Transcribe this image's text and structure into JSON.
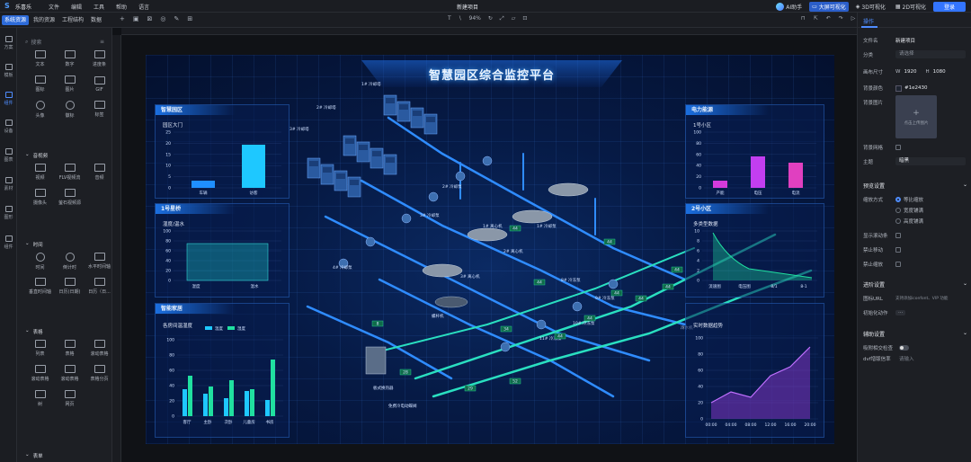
{
  "app": {
    "name": "乐喜乐",
    "doc_title": "新建项目"
  },
  "menu": [
    "文件",
    "编辑",
    "工具",
    "帮助",
    "语言"
  ],
  "top_right": {
    "ai": "AI助手",
    "big_screen": "大屏可视化",
    "viz3d": "3D可视化",
    "viz2d": "2D可视化",
    "login": "登录"
  },
  "left_tabs": [
    "系统资源",
    "我的资源",
    "工程结构",
    "数据"
  ],
  "zoom": "94%",
  "rail": [
    "方案",
    "模板",
    "组件",
    "设备",
    "图表",
    "素材",
    "图形",
    "组件"
  ],
  "panel": {
    "search_placeholder": "搜索",
    "top_items": [
      "文本",
      "数字",
      "进度条",
      "图标",
      "图片",
      "GIF",
      "头像",
      "徽标",
      "标签"
    ],
    "sec_media": "音视频",
    "media_items": [
      "视频",
      "FLV视频流",
      "音频",
      "摄像头",
      "萤石视频源"
    ],
    "sec_time": "时间",
    "time_items": [
      "时间",
      "倒计时",
      "水平时间轴",
      "垂直时间轴",
      "日历(日期)",
      "日历（日..."
    ],
    "sec_table": "表格",
    "table_items": [
      "列表",
      "表格",
      "滚动表格",
      "滚动表格",
      "滚动表格",
      "表格分页",
      "树",
      "网页"
    ],
    "sec_form": "表单"
  },
  "stage": {
    "title": "智慧园区综合监控平台",
    "p1": {
      "head": "智慧园区",
      "sub": "园区大门",
      "cats": [
        "车辆",
        "访客"
      ],
      "yticks": [
        "25",
        "20",
        "15",
        "10",
        "5",
        "0"
      ]
    },
    "p2": {
      "head": "1号星桥",
      "sub": "湿度/温水",
      "cats": [
        "湿度",
        "温水"
      ],
      "yticks": [
        "100",
        "80",
        "60",
        "40",
        "20",
        "0"
      ]
    },
    "p3": {
      "head": "智能家居",
      "sub": "各房间温湿度",
      "legend": [
        "温度",
        "湿度"
      ],
      "cats": [
        "客厅",
        "主卧",
        "次卧",
        "儿童房",
        "书房"
      ],
      "yticks": [
        "100",
        "80",
        "60",
        "40",
        "20",
        "0"
      ]
    },
    "p4": {
      "head": "电力能源",
      "sub": "1号小区",
      "cats": [
        "产能",
        "电压",
        "电流"
      ],
      "yticks": [
        "100",
        "80",
        "60",
        "40",
        "20",
        "0"
      ]
    },
    "p5": {
      "head": "2号小区",
      "sub": "多类型数据",
      "cats": [
        "流速图",
        "电压图",
        "8/1",
        "8-1"
      ],
      "yticks": [
        "10",
        "8",
        "6",
        "4",
        "2",
        "0"
      ]
    },
    "p6": {
      "head": "实时数据趋势",
      "cats": [
        "00:00",
        "04:00",
        "08:00",
        "12:00",
        "16:00",
        "20:00"
      ],
      "yticks": [
        "100",
        "80",
        "60",
        "40",
        "20",
        "0"
      ]
    },
    "labels": [
      "1# 冷却塔",
      "2# 冷却塔",
      "3# 冷却塔",
      "1# 冷却泵",
      "2# 冷却泵",
      "3# 冷却泵",
      "4# 冷却泵",
      "1# 离心机",
      "2# 离心机",
      "3# 离心机",
      "螺杆机",
      "8# 冷冻泵",
      "9# 冷冻泵",
      "10# 冷冻泵",
      "11# 冷冻泵",
      "板式换热器",
      "免费冷电动蝶阀",
      "冷水机"
    ],
    "tags": [
      "44",
      "44",
      "44",
      "44",
      "44",
      "44",
      "44",
      "44",
      "34",
      "28",
      "29",
      "52",
      "44",
      "8"
    ]
  },
  "props": {
    "tab": "操作",
    "file_name_label": "文件名",
    "file_name": "新建项目",
    "category_label": "分类",
    "category_placeholder": "请选择",
    "size_label": "画布尺寸",
    "w_label": "W",
    "w": "1920",
    "h_label": "H",
    "h": "1080",
    "bg_color_label": "背景颜色",
    "bg_color": "#1e2430",
    "bg_image_label": "背景图片",
    "upload_text": "点击上传图片",
    "bg_grid_label": "背景网格",
    "theme_label": "主题",
    "theme": "暗黑",
    "preview_sec": "预览设置",
    "zoom_mode_label": "缩放方式",
    "zoom_modes": [
      "等比缩放",
      "宽度铺满",
      "高度铺满"
    ],
    "scrollbar_label": "显示滚动条",
    "no_move_label": "禁止移动",
    "no_zoom_label": "禁止缩放",
    "adv_sec": "进阶设置",
    "icon_url_label": "图标URL",
    "icon_url_note": "支持添加iconfont、VIP 功能",
    "init_action_label": "初始化动作",
    "init_action_btn": "···",
    "aux_sec": "辅助设置",
    "snap_label": "吸附相交检查",
    "dvf_label": "dvf增版信率",
    "dvf_value": "请输入"
  }
}
